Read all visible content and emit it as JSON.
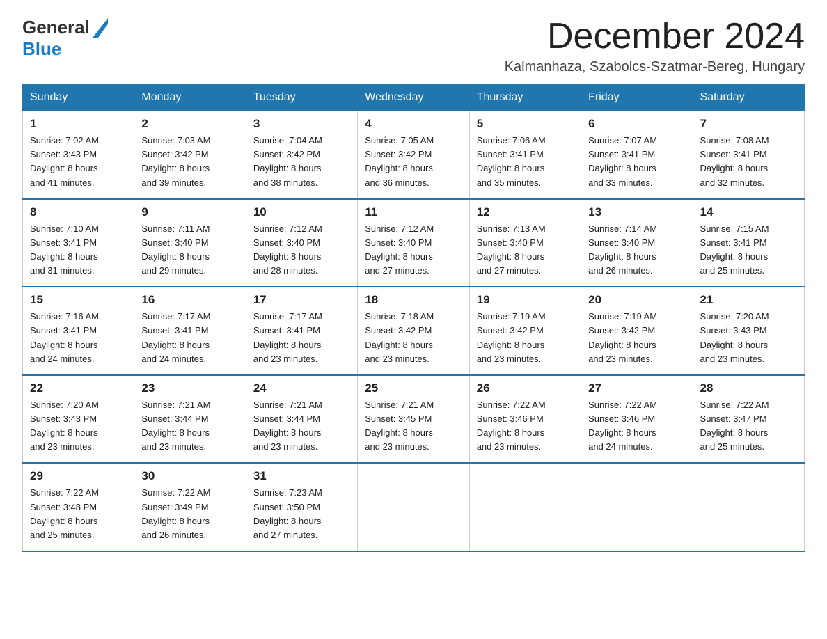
{
  "header": {
    "logo_general": "General",
    "logo_blue": "Blue",
    "month_title": "December 2024",
    "subtitle": "Kalmanhaza, Szabolcs-Szatmar-Bereg, Hungary"
  },
  "days_of_week": [
    "Sunday",
    "Monday",
    "Tuesday",
    "Wednesday",
    "Thursday",
    "Friday",
    "Saturday"
  ],
  "weeks": [
    [
      {
        "day": "1",
        "sunrise": "7:02 AM",
        "sunset": "3:43 PM",
        "daylight": "8 hours and 41 minutes."
      },
      {
        "day": "2",
        "sunrise": "7:03 AM",
        "sunset": "3:42 PM",
        "daylight": "8 hours and 39 minutes."
      },
      {
        "day": "3",
        "sunrise": "7:04 AM",
        "sunset": "3:42 PM",
        "daylight": "8 hours and 38 minutes."
      },
      {
        "day": "4",
        "sunrise": "7:05 AM",
        "sunset": "3:42 PM",
        "daylight": "8 hours and 36 minutes."
      },
      {
        "day": "5",
        "sunrise": "7:06 AM",
        "sunset": "3:41 PM",
        "daylight": "8 hours and 35 minutes."
      },
      {
        "day": "6",
        "sunrise": "7:07 AM",
        "sunset": "3:41 PM",
        "daylight": "8 hours and 33 minutes."
      },
      {
        "day": "7",
        "sunrise": "7:08 AM",
        "sunset": "3:41 PM",
        "daylight": "8 hours and 32 minutes."
      }
    ],
    [
      {
        "day": "8",
        "sunrise": "7:10 AM",
        "sunset": "3:41 PM",
        "daylight": "8 hours and 31 minutes."
      },
      {
        "day": "9",
        "sunrise": "7:11 AM",
        "sunset": "3:40 PM",
        "daylight": "8 hours and 29 minutes."
      },
      {
        "day": "10",
        "sunrise": "7:12 AM",
        "sunset": "3:40 PM",
        "daylight": "8 hours and 28 minutes."
      },
      {
        "day": "11",
        "sunrise": "7:12 AM",
        "sunset": "3:40 PM",
        "daylight": "8 hours and 27 minutes."
      },
      {
        "day": "12",
        "sunrise": "7:13 AM",
        "sunset": "3:40 PM",
        "daylight": "8 hours and 27 minutes."
      },
      {
        "day": "13",
        "sunrise": "7:14 AM",
        "sunset": "3:40 PM",
        "daylight": "8 hours and 26 minutes."
      },
      {
        "day": "14",
        "sunrise": "7:15 AM",
        "sunset": "3:41 PM",
        "daylight": "8 hours and 25 minutes."
      }
    ],
    [
      {
        "day": "15",
        "sunrise": "7:16 AM",
        "sunset": "3:41 PM",
        "daylight": "8 hours and 24 minutes."
      },
      {
        "day": "16",
        "sunrise": "7:17 AM",
        "sunset": "3:41 PM",
        "daylight": "8 hours and 24 minutes."
      },
      {
        "day": "17",
        "sunrise": "7:17 AM",
        "sunset": "3:41 PM",
        "daylight": "8 hours and 23 minutes."
      },
      {
        "day": "18",
        "sunrise": "7:18 AM",
        "sunset": "3:42 PM",
        "daylight": "8 hours and 23 minutes."
      },
      {
        "day": "19",
        "sunrise": "7:19 AM",
        "sunset": "3:42 PM",
        "daylight": "8 hours and 23 minutes."
      },
      {
        "day": "20",
        "sunrise": "7:19 AM",
        "sunset": "3:42 PM",
        "daylight": "8 hours and 23 minutes."
      },
      {
        "day": "21",
        "sunrise": "7:20 AM",
        "sunset": "3:43 PM",
        "daylight": "8 hours and 23 minutes."
      }
    ],
    [
      {
        "day": "22",
        "sunrise": "7:20 AM",
        "sunset": "3:43 PM",
        "daylight": "8 hours and 23 minutes."
      },
      {
        "day": "23",
        "sunrise": "7:21 AM",
        "sunset": "3:44 PM",
        "daylight": "8 hours and 23 minutes."
      },
      {
        "day": "24",
        "sunrise": "7:21 AM",
        "sunset": "3:44 PM",
        "daylight": "8 hours and 23 minutes."
      },
      {
        "day": "25",
        "sunrise": "7:21 AM",
        "sunset": "3:45 PM",
        "daylight": "8 hours and 23 minutes."
      },
      {
        "day": "26",
        "sunrise": "7:22 AM",
        "sunset": "3:46 PM",
        "daylight": "8 hours and 23 minutes."
      },
      {
        "day": "27",
        "sunrise": "7:22 AM",
        "sunset": "3:46 PM",
        "daylight": "8 hours and 24 minutes."
      },
      {
        "day": "28",
        "sunrise": "7:22 AM",
        "sunset": "3:47 PM",
        "daylight": "8 hours and 25 minutes."
      }
    ],
    [
      {
        "day": "29",
        "sunrise": "7:22 AM",
        "sunset": "3:48 PM",
        "daylight": "8 hours and 25 minutes."
      },
      {
        "day": "30",
        "sunrise": "7:22 AM",
        "sunset": "3:49 PM",
        "daylight": "8 hours and 26 minutes."
      },
      {
        "day": "31",
        "sunrise": "7:23 AM",
        "sunset": "3:50 PM",
        "daylight": "8 hours and 27 minutes."
      },
      null,
      null,
      null,
      null
    ]
  ],
  "labels": {
    "sunrise": "Sunrise:",
    "sunset": "Sunset:",
    "daylight": "Daylight:"
  }
}
